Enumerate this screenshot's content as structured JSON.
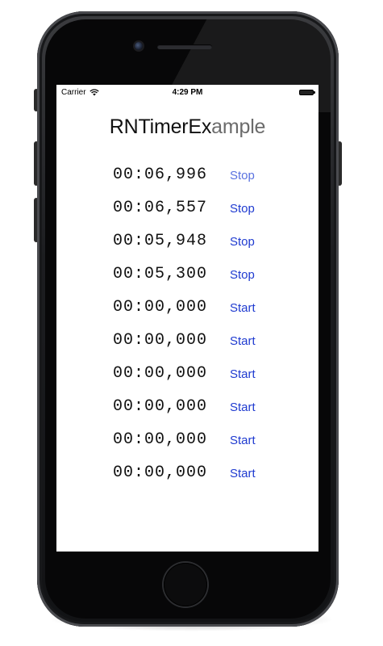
{
  "status_bar": {
    "carrier": "Carrier",
    "time": "4:29 PM",
    "wifi_icon": "wifi-icon",
    "battery_icon": "battery-icon"
  },
  "app": {
    "title_a": "RNTimerEx",
    "title_b": "ample"
  },
  "timers": [
    {
      "value": "00:06,996",
      "button": "Stop"
    },
    {
      "value": "00:06,557",
      "button": "Stop"
    },
    {
      "value": "00:05,948",
      "button": "Stop"
    },
    {
      "value": "00:05,300",
      "button": "Stop"
    },
    {
      "value": "00:00,000",
      "button": "Start"
    },
    {
      "value": "00:00,000",
      "button": "Start"
    },
    {
      "value": "00:00,000",
      "button": "Start"
    },
    {
      "value": "00:00,000",
      "button": "Start"
    },
    {
      "value": "00:00,000",
      "button": "Start"
    },
    {
      "value": "00:00,000",
      "button": "Start"
    }
  ],
  "colors": {
    "button_text": "#1f3bd0",
    "phone_body": "#1c1d20",
    "screen_background": "#ffffff"
  }
}
